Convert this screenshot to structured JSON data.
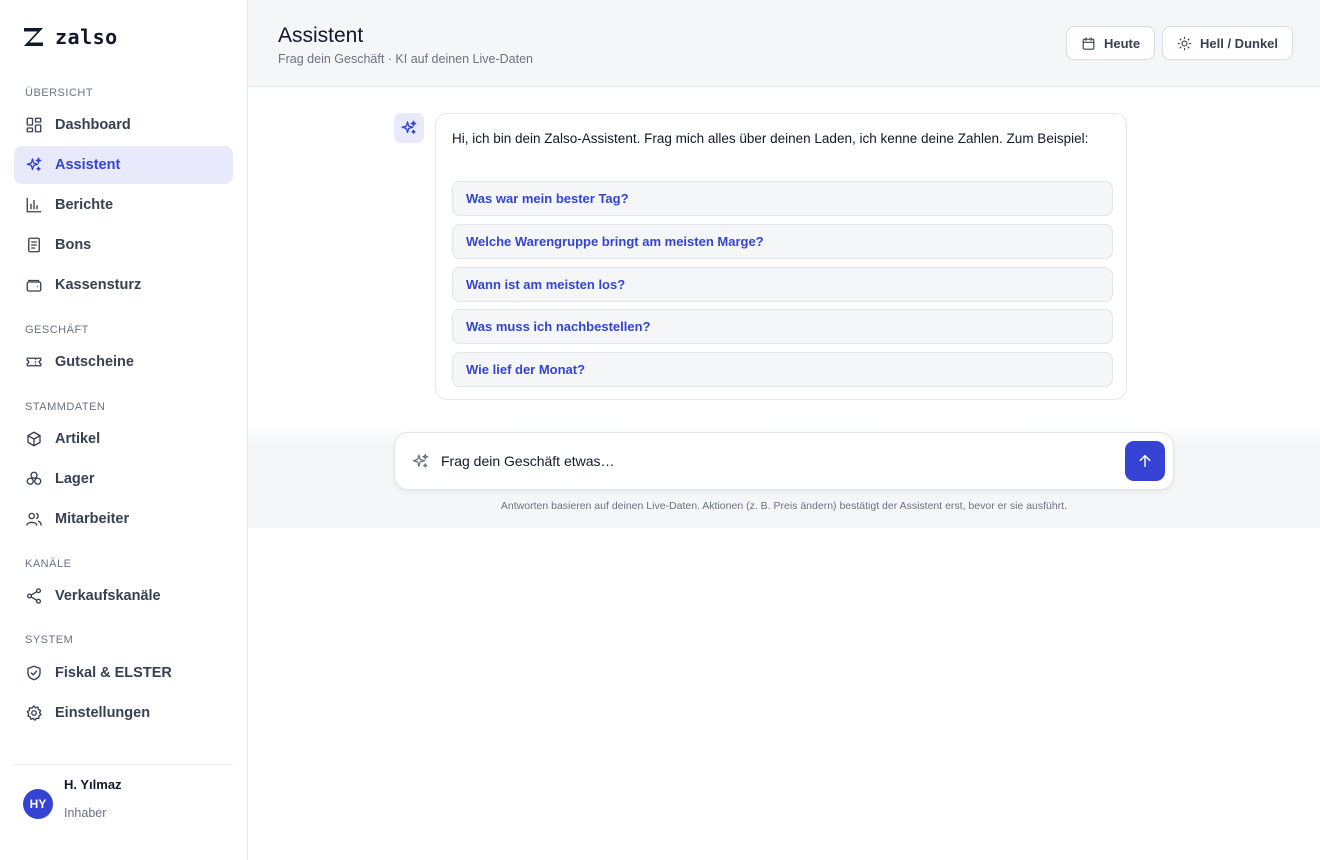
{
  "app": {
    "logo_text": "zalso"
  },
  "sidebar": {
    "sections": [
      {
        "label": "ÜBERSICHT",
        "items": [
          {
            "label": "Dashboard",
            "icon": "grid-icon"
          },
          {
            "label": "Assistent",
            "icon": "sparkle-icon",
            "active": true
          },
          {
            "label": "Berichte",
            "icon": "bar-chart-icon"
          },
          {
            "label": "Bons",
            "icon": "receipt-icon"
          },
          {
            "label": "Kassensturz",
            "icon": "wallet-icon"
          }
        ]
      },
      {
        "label": "GESCHÄFT",
        "items": [
          {
            "label": "Gutscheine",
            "icon": "ticket-icon"
          }
        ]
      },
      {
        "label": "STAMMDATEN",
        "items": [
          {
            "label": "Artikel",
            "icon": "box-icon"
          },
          {
            "label": "Lager",
            "icon": "stock-icon"
          },
          {
            "label": "Mitarbeiter",
            "icon": "users-icon"
          }
        ]
      },
      {
        "label": "KANÄLE",
        "items": [
          {
            "label": "Verkaufskanäle",
            "icon": "share-icon"
          }
        ]
      },
      {
        "label": "SYSTEM",
        "items": [
          {
            "label": "Fiskal & ELSTER",
            "icon": "shield-icon"
          },
          {
            "label": "Einstellungen",
            "icon": "gear-icon"
          }
        ]
      }
    ],
    "user": {
      "initials": "HY",
      "name": "H. Yılmaz",
      "role": "Inhaber"
    }
  },
  "header": {
    "title": "Assistent",
    "subtitle": "Frag dein Geschäft · KI auf deinen Live-Daten",
    "today_label": "Heute",
    "theme_label": "Hell / Dunkel"
  },
  "chat": {
    "greeting": "Hi, ich bin dein Zalso-Assistent. Frag mich alles über deinen Laden, ich kenne deine Zahlen. Zum Beispiel:",
    "suggestions": [
      "Was war mein bester Tag?",
      "Welche Warengruppe bringt am meisten Marge?",
      "Wann ist am meisten los?",
      "Was muss ich nachbestellen?",
      "Wie lief der Monat?"
    ]
  },
  "composer": {
    "placeholder": "Frag dein Geschäft etwas…",
    "disclaimer": "Antworten basieren auf deinen Live-Daten. Aktionen (z. B. Preis ändern) bestätigt der Assistent erst, bevor er sie ausführt."
  },
  "colors": {
    "accent": "#3443d3",
    "accent_soft": "#e8eafc",
    "text": "#111827",
    "muted": "#6b7280"
  }
}
